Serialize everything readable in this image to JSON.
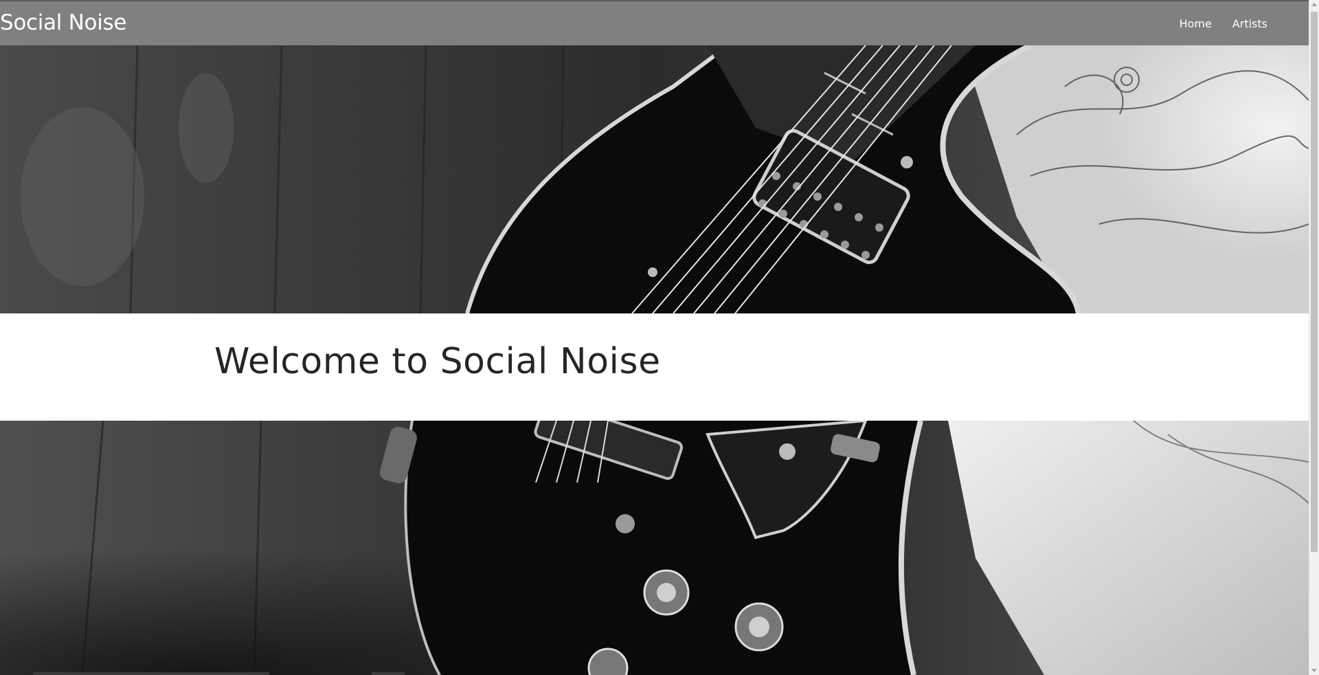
{
  "navbar": {
    "brand": "Social Noise",
    "links": [
      {
        "label": "Home"
      },
      {
        "label": "Artists"
      }
    ]
  },
  "hero": {
    "image": "guitar-photo",
    "welcome_title": "Welcome to Social Noise"
  },
  "colors": {
    "navbar_bg": "#808080",
    "band_bg": "#ffffff",
    "title_text": "#262626"
  }
}
